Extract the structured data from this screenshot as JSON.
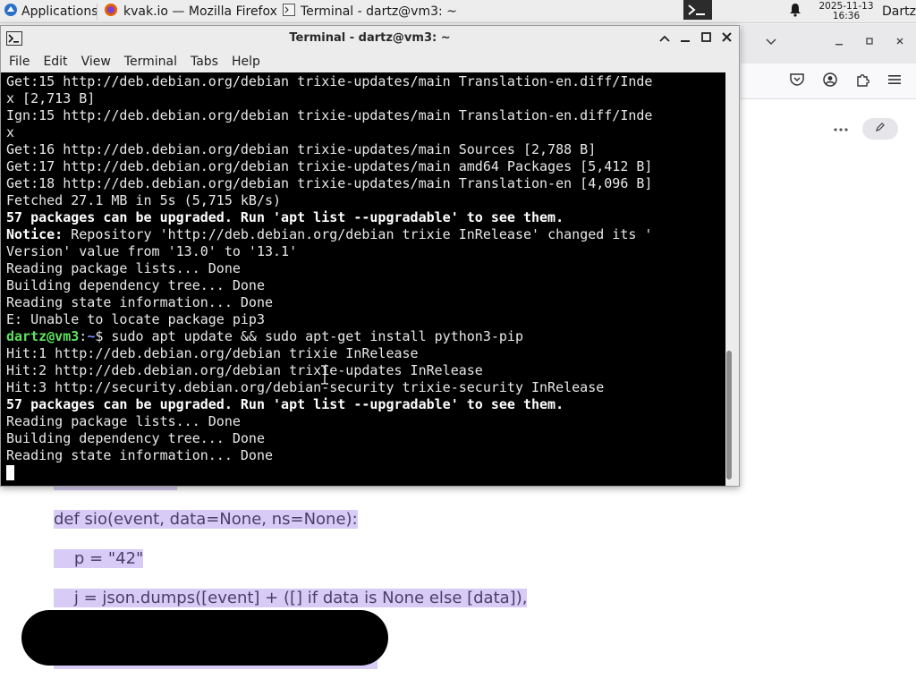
{
  "panel": {
    "applications_label": "Applications",
    "tasks": [
      {
        "label": "kvak.io — Mozilla Firefox",
        "icon": "firefox-icon"
      },
      {
        "label": "Terminal - dartz@vm3: ~",
        "icon": "terminal-icon"
      }
    ],
    "clock": {
      "date": "2025-11-13",
      "time": "16:36"
    },
    "user": "Dartz"
  },
  "terminal": {
    "title": "Terminal - dartz@vm3: ~",
    "menu": [
      "File",
      "Edit",
      "View",
      "Terminal",
      "Tabs",
      "Help"
    ],
    "lines": [
      {
        "text": "Get:15 http://deb.debian.org/debian trixie-updates/main Translation-en.diff/Inde"
      },
      {
        "text": "x [2,713 B]"
      },
      {
        "text": "Ign:15 http://deb.debian.org/debian trixie-updates/main Translation-en.diff/Inde"
      },
      {
        "text": "x"
      },
      {
        "text": "Get:16 http://deb.debian.org/debian trixie-updates/main Sources [2,788 B]"
      },
      {
        "text": "Get:17 http://deb.debian.org/debian trixie-updates/main amd64 Packages [5,412 B]"
      },
      {
        "text": "Get:18 http://deb.debian.org/debian trixie-updates/main Translation-en [4,096 B]"
      },
      {
        "text": "Fetched 27.1 MB in 5s (5,715 kB/s)"
      },
      {
        "text": "57 packages can be upgraded. Run 'apt list --upgradable' to see them.",
        "bold": true
      },
      {
        "notice_label": "Notice:",
        "text": " Repository 'http://deb.debian.org/debian trixie InRelease' changed its '"
      },
      {
        "text": "Version' value from '13.0' to '13.1'"
      },
      {
        "text": "Reading package lists... Done"
      },
      {
        "text": "Building dependency tree... Done"
      },
      {
        "text": "Reading state information... Done"
      },
      {
        "text": "E: Unable to locate package pip3"
      },
      {
        "prompt_user": "dartz@vm3",
        "prompt_sep": ":",
        "prompt_path": "~",
        "prompt_end": "$",
        "text": " sudo apt update && sudo apt-get install python3-pip"
      },
      {
        "text": "Hit:1 http://deb.debian.org/debian trixie InRelease"
      },
      {
        "text": "Hit:2 http://deb.debian.org/debian trixie-updates InRelease"
      },
      {
        "text": "Hit:3 http://security.debian.org/debian-security trixie-security InRelease"
      },
      {
        "text": "57 packages can be upgraded. Run 'apt list --upgradable' to see them.",
        "bold": true
      },
      {
        "text": "Reading package lists... Done"
      },
      {
        "text": "Building dependency tree... Done"
      },
      {
        "text": "Reading state information... Done"
      }
    ]
  },
  "page_behind": {
    "code_lines": [
      "def sio(event, data=None, ns=None):",
      "    p = \"42\"",
      "    j = json.dumps([event] + ([] if data is None else [data]),"
    ],
    "toast_text": ""
  },
  "colors": {
    "terminal_bg": "#000000",
    "terminal_fg": "#e8e8e8",
    "prompt_user": "#5ee25e",
    "prompt_path": "#6e8cff",
    "code_highlight": "#d8ccf6"
  }
}
